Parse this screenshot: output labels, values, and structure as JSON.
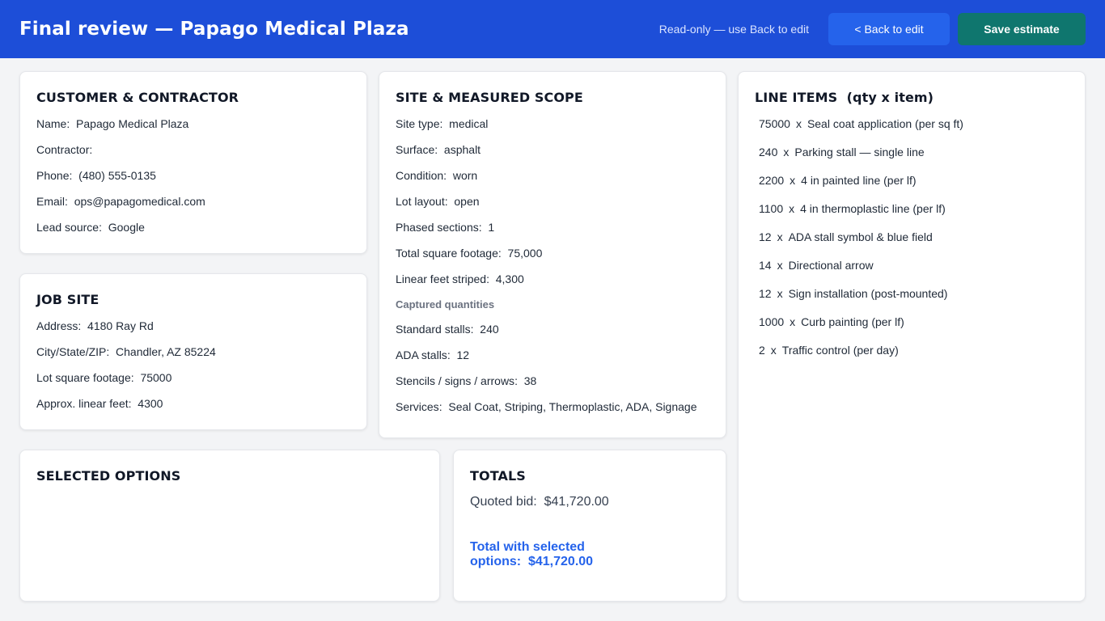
{
  "header": {
    "title": "Final review — Papago Medical Plaza",
    "readonly_note": "Read-only — use Back to edit",
    "back_label": "< Back to edit",
    "save_label": "Save estimate"
  },
  "customer": {
    "heading": "CUSTOMER & CONTRACTOR",
    "rows": [
      {
        "label": "Name",
        "value": "Papago Medical Plaza"
      },
      {
        "label": "Contractor",
        "value": ""
      },
      {
        "label": "Phone",
        "value": "(480) 555-0135"
      },
      {
        "label": "Email",
        "value": "ops@papagomedical.com"
      },
      {
        "label": "Lead source",
        "value": "Google"
      }
    ]
  },
  "job_site": {
    "heading": "JOB SITE",
    "rows": [
      {
        "label": "Address",
        "value": "4180 Ray Rd"
      },
      {
        "label": "City/State/ZIP",
        "value": "Chandler, AZ 85224"
      },
      {
        "label": "Lot square footage",
        "value": "75000"
      },
      {
        "label": "Approx. linear feet",
        "value": "4300"
      }
    ]
  },
  "scope": {
    "heading": "SITE & MEASURED SCOPE",
    "rows": [
      {
        "label": "Site type",
        "value": "medical"
      },
      {
        "label": "Surface",
        "value": "asphalt"
      },
      {
        "label": "Condition",
        "value": "worn"
      },
      {
        "label": "Lot layout",
        "value": "open"
      },
      {
        "label": "Phased sections",
        "value": "1"
      },
      {
        "label": "Total square footage",
        "value": "75,000"
      },
      {
        "label": "Linear feet striped",
        "value": "4,300"
      }
    ],
    "captured_heading": "Captured quantities",
    "captured_rows": [
      {
        "label": "Standard stalls",
        "value": "240"
      },
      {
        "label": "ADA stalls",
        "value": "12"
      },
      {
        "label": "Stencils / signs / arrows",
        "value": "38"
      },
      {
        "label": "Services",
        "value": "Seal Coat, Striping, Thermoplastic, ADA, Signage"
      }
    ]
  },
  "line_items": {
    "heading": "LINE ITEMS  (qty x item)",
    "separator": "x",
    "items": [
      {
        "qty": "75000",
        "item": "Seal coat application (per sq ft)"
      },
      {
        "qty": "240",
        "item": "Parking stall — single line"
      },
      {
        "qty": "2200",
        "item": "4 in painted line (per lf)"
      },
      {
        "qty": "1100",
        "item": "4 in thermoplastic line (per lf)"
      },
      {
        "qty": "12",
        "item": "ADA stall symbol & blue field"
      },
      {
        "qty": "14",
        "item": "Directional arrow"
      },
      {
        "qty": "12",
        "item": "Sign installation (post-mounted)"
      },
      {
        "qty": "1000",
        "item": "Curb painting (per lf)"
      },
      {
        "qty": "2",
        "item": "Traffic control (per day)"
      }
    ]
  },
  "options": {
    "heading": "SELECTED OPTIONS"
  },
  "totals": {
    "heading": "TOTALS",
    "quoted_label": "Quoted bid",
    "quoted_value": "$41,720.00",
    "with_options_label": "Total with selected options",
    "with_options_value": "$41,720.00"
  }
}
